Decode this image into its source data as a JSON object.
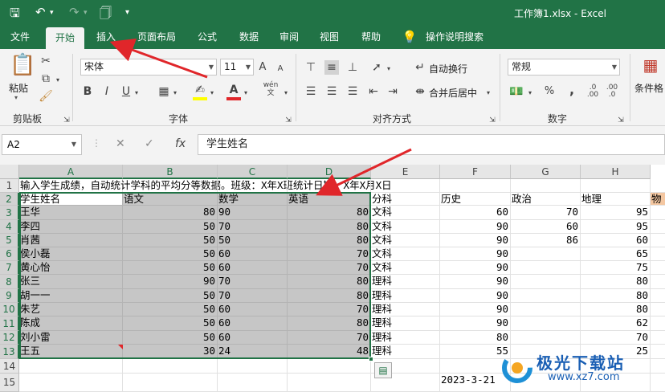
{
  "window": {
    "title": "工作簿1.xlsx  -  Excel"
  },
  "tabs": [
    {
      "label": "文件"
    },
    {
      "label": "开始"
    },
    {
      "label": "插入"
    },
    {
      "label": "页面布局"
    },
    {
      "label": "公式"
    },
    {
      "label": "数据"
    },
    {
      "label": "审阅"
    },
    {
      "label": "视图"
    },
    {
      "label": "帮助"
    },
    {
      "label": "操作说明搜索"
    }
  ],
  "ribbon": {
    "clipboard": {
      "paste": "粘贴",
      "group": "剪贴板"
    },
    "font": {
      "name": "宋体",
      "size": "11",
      "group": "字体",
      "bold": "B",
      "italic": "I",
      "underline": "U",
      "grow": "A",
      "shrink": "A",
      "font_color": "A",
      "phonetic": "wén"
    },
    "alignment": {
      "wrap": "自动换行",
      "merge": "合并后居中",
      "group": "对齐方式"
    },
    "number": {
      "format": "常规",
      "group": "数字",
      "percent": "%",
      "comma": ","
    },
    "styles": {
      "conditional": "条件格"
    }
  },
  "formula_bar": {
    "name_box": "A2",
    "fx": "fx",
    "content": "学生姓名"
  },
  "sheet": {
    "columns": [
      "A",
      "B",
      "C",
      "D",
      "E",
      "F",
      "G",
      "H"
    ],
    "row_numbers": [
      "1",
      "2",
      "3",
      "4",
      "5",
      "6",
      "7",
      "8",
      "9",
      "10",
      "11",
      "12",
      "13",
      "14",
      "15"
    ],
    "row1": "输入学生成绩，自动统计学科的平均分等数据。班级：X年X班统计日期：X年X月X日",
    "header": [
      "学生姓名",
      "语文",
      "数学",
      "英语",
      "分科",
      "历史",
      "政治",
      "地理",
      "物"
    ],
    "rows": [
      [
        "王华",
        "80",
        "90",
        "80",
        "文科",
        "60",
        "70",
        "95"
      ],
      [
        "李四",
        "50",
        "70",
        "80",
        "文科",
        "90",
        "60",
        "95"
      ],
      [
        "肖茜",
        "50",
        "50",
        "80",
        "文科",
        "90",
        "86",
        "60"
      ],
      [
        "侯小磊",
        "50",
        "60",
        "70",
        "文科",
        "90",
        "",
        "65"
      ],
      [
        "黄心怡",
        "50",
        "60",
        "70",
        "文科",
        "90",
        "",
        "75"
      ],
      [
        "张三",
        "90",
        "70",
        "80",
        "理科",
        "90",
        "",
        "80"
      ],
      [
        "胡一一",
        "50",
        "70",
        "80",
        "理科",
        "90",
        "",
        "80"
      ],
      [
        "朱艺",
        "50",
        "60",
        "70",
        "理科",
        "90",
        "",
        "80"
      ],
      [
        "陈成",
        "50",
        "60",
        "80",
        "理科",
        "90",
        "",
        "62"
      ],
      [
        "刘小雷",
        "50",
        "60",
        "70",
        "理科",
        "80",
        "",
        "70"
      ],
      [
        "王五",
        "30",
        "24",
        "48",
        "理科",
        "55",
        "",
        "25"
      ]
    ],
    "row15_f": "2023-3-21"
  },
  "watermark": {
    "brand": "极光下载站",
    "url": "www.xz7.com"
  },
  "colors": {
    "excel_green": "#217346",
    "arrow_red": "#e0262a",
    "selection_gray": "#c6c6c6"
  }
}
